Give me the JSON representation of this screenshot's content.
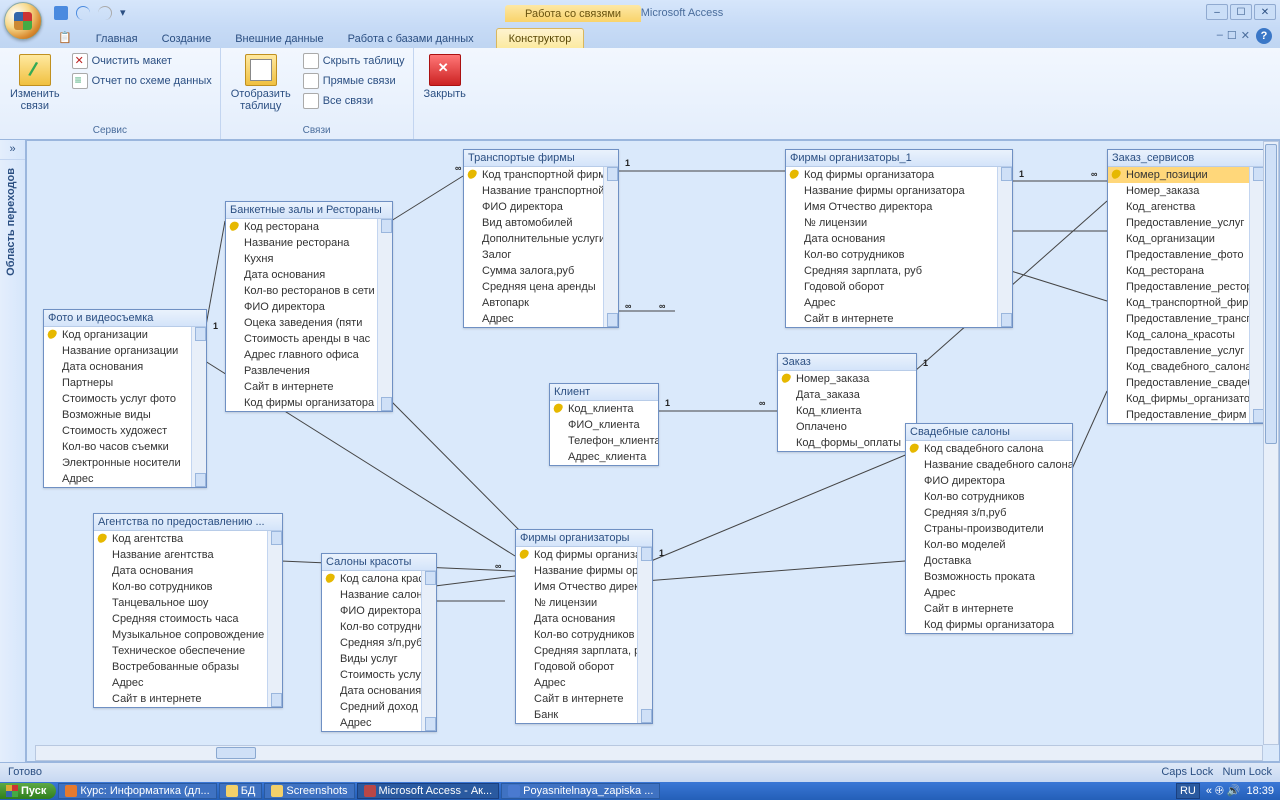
{
  "window": {
    "title": "Схема данных - Microsoft Access",
    "context_tab_group": "Работа со связями"
  },
  "tabs": {
    "special": "",
    "home": "Главная",
    "create": "Создание",
    "external": "Внешние данные",
    "dbtools": "Работа с базами данных",
    "designer": "Конструктор"
  },
  "ribbon": {
    "edit_rel": "Изменить\nсвязи",
    "clear_layout": "Очистить макет",
    "rel_report": "Отчет по схеме данных",
    "group_service": "Сервис",
    "show_table": "Отобразить\nтаблицу",
    "hide_table": "Скрыть таблицу",
    "direct_rel": "Прямые связи",
    "all_rel": "Все связи",
    "group_rel": "Связи",
    "close": "Закрыть"
  },
  "nav": {
    "toggle": "»",
    "label": "Область переходов"
  },
  "tables": {
    "photo": {
      "title": "Фото и видеосъемка",
      "fields": [
        "Код организации",
        "Название организации",
        "Дата основания",
        "Партнеры",
        "Стоимость услуг фото",
        "Возможные виды",
        "Стоимость художест",
        "Кол-во часов съемки",
        "Электронные носители",
        "Адрес"
      ]
    },
    "banquet": {
      "title": "Банкетные залы и Рестораны",
      "fields": [
        "Код ресторана",
        "Название ресторана",
        "Кухня",
        "Дата основания",
        "Кол-во ресторанов в сети",
        "ФИО директора",
        "Оцека заведения (пяти",
        "Стоимость аренды в час",
        "Адрес главного офиса",
        "Развлечения",
        "Сайт в интернете",
        "Код фирмы организатора"
      ]
    },
    "transport": {
      "title": "Транспортые фирмы",
      "fields": [
        "Код транспортной фирмы",
        "Название транспортной",
        "ФИО директора",
        "Вид автомобилей",
        "Дополнительные услуги",
        "Залог",
        "Сумма залога,руб",
        "Средняя цена аренды",
        "Автопарк",
        "Адрес"
      ]
    },
    "org1": {
      "title": "Фирмы организаторы_1",
      "fields": [
        "Код фирмы организатора",
        "Название фирмы организатора",
        "Имя Отчество директора",
        "№ лицензии",
        "Дата основания",
        "Кол-во сотрудников",
        "Средняя зарплата, руб",
        "Годовой оборот",
        "Адрес",
        "Сайт в интернете"
      ]
    },
    "services": {
      "title": "Заказ_сервисов",
      "fields": [
        "Номер_позиции",
        "Номер_заказа",
        "Код_агенства",
        "Предоставление_услуг",
        "Код_организации",
        "Предоставление_фото",
        "Код_ресторана",
        "Предоставление_ресторан",
        "Код_транспортной_фирмы",
        "Предоставление_транспорт",
        "Код_салона_красоты",
        "Предоставление_услуг",
        "Код_свадебного_салона",
        "Предоставление_свадеб",
        "Код_фирмы_организатора",
        "Предоставление_фирм"
      ]
    },
    "client": {
      "title": "Клиент",
      "fields": [
        "Код_клиента",
        "ФИО_клиента",
        "Телефон_клиента",
        "Адрес_клиента"
      ]
    },
    "order": {
      "title": "Заказ",
      "fields": [
        "Номер_заказа",
        "Дата_заказа",
        "Код_клиента",
        "Оплачено",
        "Код_формы_оплаты"
      ]
    },
    "wedding": {
      "title": "Свадебные салоны",
      "fields": [
        "Код свадебного салона",
        "Название свадебного салона",
        "ФИО директора",
        "Кол-во сотрудников",
        "Средняя з/п,руб",
        "Страны-производители",
        "Кол-во моделей",
        "Доставка",
        "Возможность проката",
        "Адрес",
        "Сайт в интернете",
        "Код фирмы организатора"
      ]
    },
    "agency": {
      "title": "Агентства по предоставлению ...",
      "fields": [
        "Код агентства",
        "Название агентства",
        "Дата основания",
        "Кол-во сотрудников",
        "Танцевальное шоу",
        "Средняя стоимость часа",
        "Музыкальное сопровождение",
        "Техническое обеспечение",
        "Востребованные образы",
        "Адрес",
        "Сайт в интернете"
      ]
    },
    "beauty": {
      "title": "Салоны красоты",
      "fields": [
        "Код салона красоты",
        "Название салона красоты",
        "ФИО директора",
        "Кол-во сотрудников",
        "Средняя з/п,руб",
        "Виды услуг",
        "Стоимость услуг,руб",
        "Дата основания",
        "Средний доход в месяц",
        "Адрес"
      ]
    },
    "org": {
      "title": "Фирмы организаторы",
      "fields": [
        "Код фирмы организатора",
        "Название фирмы организатора",
        "Имя Отчество директора",
        "№ лицензии",
        "Дата основания",
        "Кол-во сотрудников",
        "Средняя зарплата, руб",
        "Годовой оборот",
        "Адрес",
        "Сайт в интернете",
        "Банк"
      ]
    }
  },
  "status": {
    "ready": "Готово",
    "caps": "Caps Lock",
    "num": "Num Lock"
  },
  "taskbar": {
    "start": "Пуск",
    "items": [
      "Курс: Информатика (дл...",
      "БД",
      "Screenshots",
      "Microsoft Access - Ак...",
      "Poyasnitelnaya_zapiska ..."
    ],
    "lang": "RU",
    "time": "18:39"
  }
}
